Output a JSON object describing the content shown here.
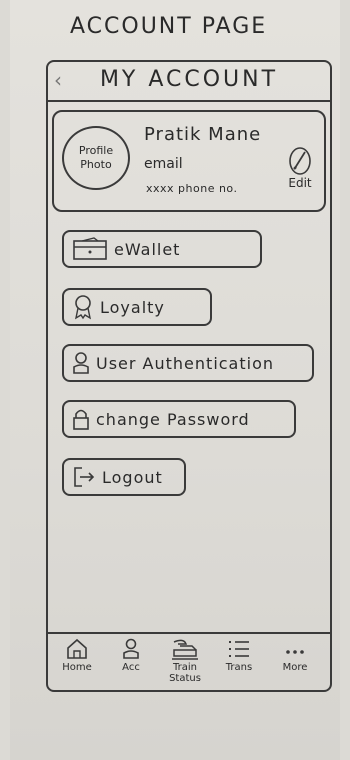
{
  "page_heading": "ACCOUNT PAGE",
  "header": {
    "title": "MY ACCOUNT",
    "back_icon": "chevron-left-icon"
  },
  "profile": {
    "photo_placeholder": "Profile Photo",
    "name": "Pratik Mane",
    "email": "email",
    "phone": "xxxx phone no.",
    "edit_label": "Edit",
    "edit_icon": "pencil-icon"
  },
  "menu": [
    {
      "label": "eWallet",
      "icon": "wallet-icon"
    },
    {
      "label": "Loyalty",
      "icon": "award-icon"
    },
    {
      "label": "User Authentication",
      "icon": "user-icon"
    },
    {
      "label": "change Password",
      "icon": "lock-icon"
    },
    {
      "label": "Logout",
      "icon": "logout-icon"
    }
  ],
  "tabbar": [
    {
      "label": "Home",
      "icon": "home-icon"
    },
    {
      "label": "Acc",
      "icon": "user-icon"
    },
    {
      "label": "Train Status",
      "icon": "train-icon"
    },
    {
      "label": "Trans",
      "icon": "list-icon"
    },
    {
      "label": "More",
      "icon": "more-icon"
    }
  ]
}
